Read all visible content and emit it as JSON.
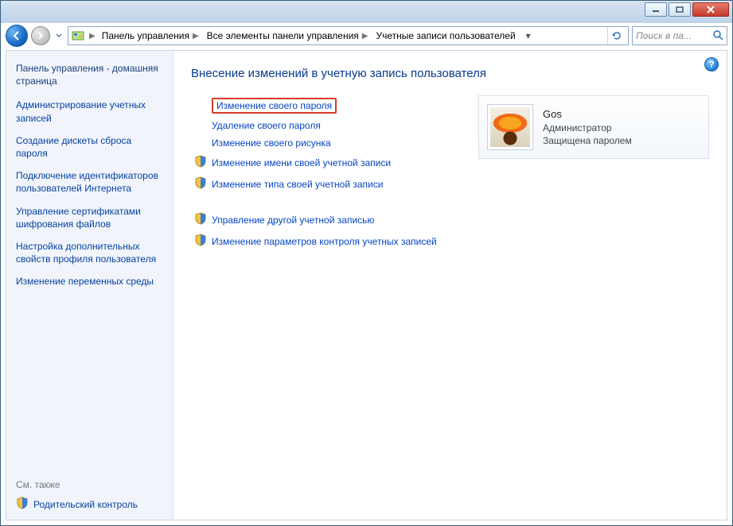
{
  "window_controls": {
    "minimize": "minimize",
    "maximize": "maximize",
    "close": "close"
  },
  "breadcrumb": {
    "items": [
      "Панель управления",
      "Все элементы панели управления",
      "Учетные записи пользователей"
    ]
  },
  "search": {
    "placeholder": "Поиск в па..."
  },
  "sidebar": {
    "home_label": "Панель управления - домашняя страница",
    "links": [
      "Администрирование учетных записей",
      "Создание дискеты сброса пароля",
      "Подключение идентификаторов пользователей Интернета",
      "Управление сертификатами шифрования файлов",
      "Настройка дополнительных свойств профиля пользователя",
      "Изменение переменных среды"
    ],
    "see_also_label": "См. также",
    "footer_link": "Родительский контроль"
  },
  "content": {
    "heading": "Внесение изменений в учетную запись пользователя",
    "actions_primary": [
      {
        "label": "Изменение своего пароля",
        "shield": false,
        "highlight": true
      },
      {
        "label": "Удаление своего пароля",
        "shield": false,
        "highlight": false
      },
      {
        "label": "Изменение своего рисунка",
        "shield": false,
        "highlight": false
      },
      {
        "label": "Изменение имени своей учетной записи",
        "shield": true,
        "highlight": false
      },
      {
        "label": "Изменение типа своей учетной записи",
        "shield": true,
        "highlight": false
      }
    ],
    "actions_secondary": [
      {
        "label": "Управление другой учетной записью",
        "shield": true
      },
      {
        "label": "Изменение параметров контроля учетных записей",
        "shield": true
      }
    ]
  },
  "user_card": {
    "name": "Gos",
    "role": "Администратор",
    "status": "Защищена паролем"
  },
  "help": "?"
}
